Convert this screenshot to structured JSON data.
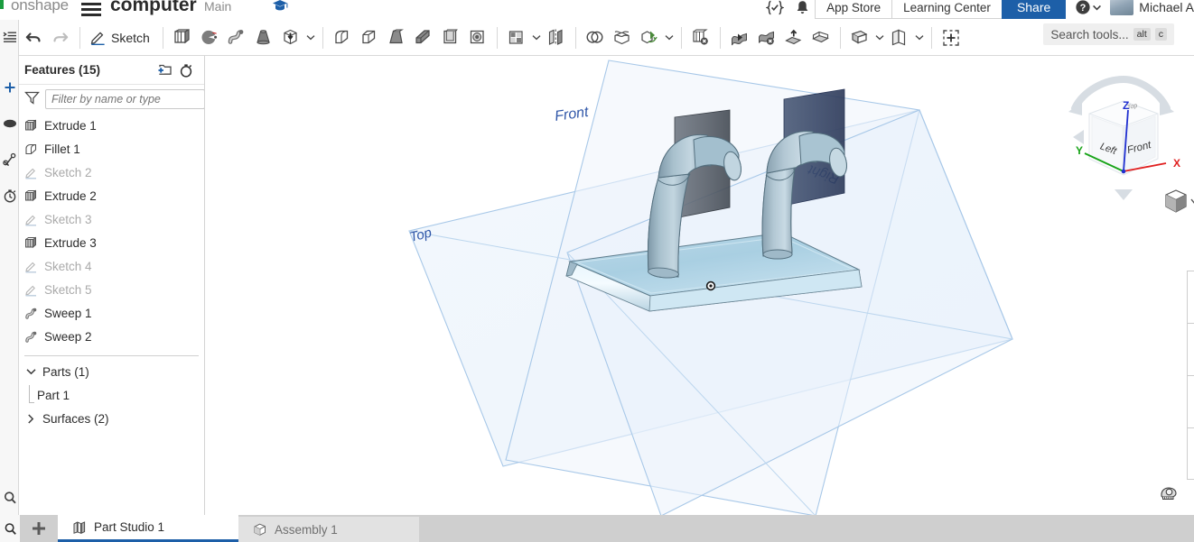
{
  "header": {
    "brand": "onshape",
    "document_title": "computer",
    "branch": "Main",
    "gradcap_icon": "graduation-cap-icon",
    "tasks_icon": "tasks-icon",
    "bell_icon": "bell-icon",
    "notification_count": "",
    "app_store_label": "App Store",
    "learning_center_label": "Learning Center",
    "share_label": "Share",
    "help_icon": "help-circle-icon",
    "user_name": "Michael A",
    "accent_color": "#1d5fa8",
    "brand_green": "#1a9c3f"
  },
  "toolbar": {
    "undo_icon": "undo-icon",
    "redo_icon": "redo-icon",
    "sketch_label": "Sketch",
    "sketch_icon": "pencil-icon",
    "items": [
      {
        "name": "extrude-icon",
        "label": "Extrude"
      },
      {
        "name": "revolve-icon",
        "label": "Revolve"
      },
      {
        "name": "sweep-icon",
        "label": "Sweep"
      },
      {
        "name": "loft-icon",
        "label": "Loft"
      },
      {
        "name": "thicken-icon",
        "label": "Thicken"
      },
      {
        "name": "fillet-icon",
        "label": "Fillet"
      },
      {
        "name": "chamfer-icon",
        "label": "Chamfer"
      },
      {
        "name": "draft-icon",
        "label": "Draft"
      },
      {
        "name": "rib-icon",
        "label": "Rib"
      },
      {
        "name": "shell-icon",
        "label": "Shell"
      },
      {
        "name": "hole-icon",
        "label": "Hole"
      },
      {
        "name": "pattern-icon",
        "label": "Pattern"
      },
      {
        "name": "mirror-icon",
        "label": "Mirror"
      },
      {
        "name": "boolean-icon",
        "label": "Boolean"
      },
      {
        "name": "split-icon",
        "label": "Split"
      },
      {
        "name": "transform-icon",
        "label": "Transform"
      },
      {
        "name": "delete-part-icon",
        "label": "Delete part"
      },
      {
        "name": "move-face-icon",
        "label": "Move face"
      },
      {
        "name": "delete-face-icon",
        "label": "Delete face"
      },
      {
        "name": "offset-surface-icon",
        "label": "Offset surface"
      },
      {
        "name": "enclose-icon",
        "label": "Enclose"
      },
      {
        "name": "plane-icon",
        "label": "Plane"
      },
      {
        "name": "sketch-plane-icon",
        "label": "Construction plane"
      },
      {
        "name": "variable-icon",
        "label": "Variable"
      }
    ],
    "search_placeholder": "Search tools...",
    "search_kbd_1": "alt",
    "search_kbd_2": "c"
  },
  "left_rail": {
    "items": [
      {
        "name": "feature-list-icon",
        "label": "Feature list"
      },
      {
        "name": "insert-icon",
        "label": "Insert"
      },
      {
        "name": "appearance-icon",
        "label": "Appearance"
      },
      {
        "name": "mate-icon",
        "label": "Mate connector"
      },
      {
        "name": "history-icon",
        "label": "History"
      }
    ],
    "bottom_icon": "search-document-icon"
  },
  "feature_panel": {
    "title": "Features (15)",
    "add_folder_icon": "add-folder-icon",
    "rollback_icon": "stopwatch-icon",
    "filter_icon": "funnel-icon",
    "filter_placeholder": "Filter by name or type",
    "filter_value": "",
    "features": [
      {
        "label": "Extrude 1",
        "icon": "extrude-icon",
        "suppressed": false
      },
      {
        "label": "Fillet 1",
        "icon": "fillet-icon",
        "suppressed": false
      },
      {
        "label": "Sketch 2",
        "icon": "sketch-icon",
        "suppressed": true
      },
      {
        "label": "Extrude 2",
        "icon": "extrude-icon",
        "suppressed": false
      },
      {
        "label": "Sketch 3",
        "icon": "sketch-icon",
        "suppressed": true
      },
      {
        "label": "Extrude 3",
        "icon": "extrude-icon",
        "suppressed": false
      },
      {
        "label": "Sketch 4",
        "icon": "sketch-icon",
        "suppressed": true
      },
      {
        "label": "Sketch 5",
        "icon": "sketch-icon",
        "suppressed": true
      },
      {
        "label": "Sweep 1",
        "icon": "sweep-icon",
        "suppressed": false
      },
      {
        "label": "Sweep 2",
        "icon": "sweep-icon",
        "suppressed": false
      }
    ],
    "parts_group": {
      "label": "Parts (1)",
      "expanded": true,
      "children": [
        {
          "label": "Part 1"
        }
      ]
    },
    "surfaces_group": {
      "label": "Surfaces (2)",
      "expanded": false
    },
    "panel_toggle_icon": "list-panel-icon"
  },
  "viewport": {
    "plane_labels": {
      "front": "Front",
      "top": "Top",
      "right": "Right"
    },
    "view_cube": {
      "face_front": "Front",
      "face_left": "Left",
      "face_top": "Top",
      "axis_x": "X",
      "axis_y": "Y",
      "axis_z": "Z",
      "axis_x_color": "#e02020",
      "axis_y_color": "#17a317",
      "axis_z_color": "#2030d0"
    },
    "view_mode_icon": "shaded-cube-icon",
    "measure_icon": "measure-tape-icon",
    "plane_stroke": "#a8c8e8",
    "part_color": "#9db8c8"
  },
  "tabbar": {
    "search_icon": "search-tab-icon",
    "add_label": "+",
    "tabs": [
      {
        "label": "Part Studio 1",
        "icon": "part-studio-icon",
        "active": true
      },
      {
        "label": "Assembly 1",
        "icon": "assembly-icon",
        "active": false
      }
    ]
  }
}
